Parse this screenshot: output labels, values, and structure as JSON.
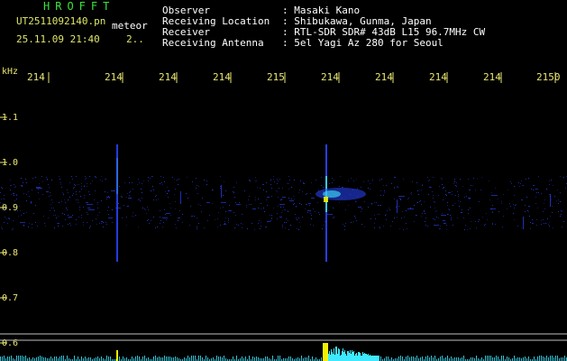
{
  "header": {
    "app_title": "HROFFT",
    "file_name": "UT2511092140.pn",
    "mode_tag": "meteor",
    "datetime": "25.11.09 21:40",
    "datetime_extra": "2..",
    "info": [
      {
        "label": "Observer",
        "value": ": Masaki Kano"
      },
      {
        "label": "Receiving Location",
        "value": ": Shibukawa, Gunma, Japan"
      },
      {
        "label": "Receiver",
        "value": ": RTL-SDR SDR# 43dB L15 96.7MHz CW"
      },
      {
        "label": "Receiving Antenna",
        "value": ": 5el Yagi Az 280 for Seoul"
      }
    ]
  },
  "axes": {
    "y_unit": "kHz",
    "x_ticks": [
      "214",
      "214",
      "214",
      "214",
      "215",
      "214",
      "214",
      "214",
      "214",
      "2150"
    ],
    "y_ticks": [
      "1.1",
      "1.0",
      "0.9",
      "0.8",
      "0.7",
      "0.6"
    ]
  },
  "colors": {
    "background": "#000000",
    "text_yellow": "#e9e66e",
    "title_green": "#39e23b",
    "signal_blue": "#2a46ff",
    "signal_cyan": "#3ee8ff",
    "signal_yellow": "#f4f000",
    "guide_lines": "#bfbfbf"
  }
}
